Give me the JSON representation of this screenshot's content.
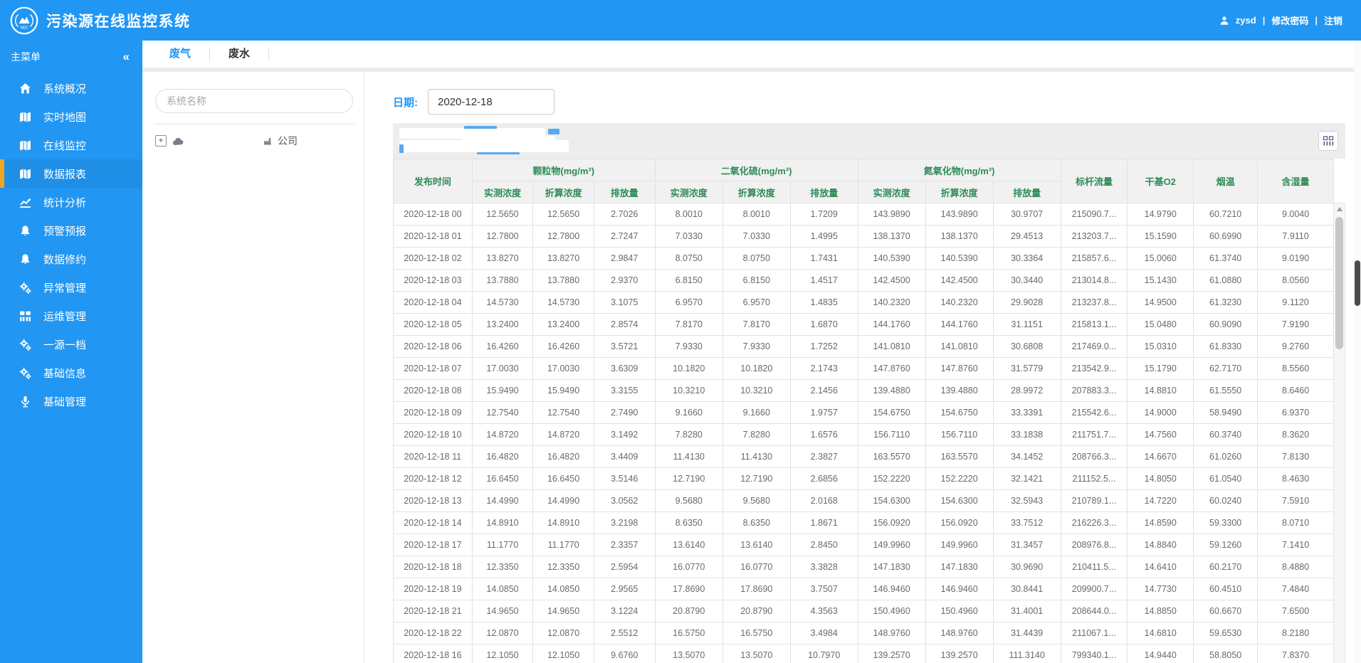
{
  "colors": {
    "primary": "#2196F3",
    "accent_yellow": "#F2A61F",
    "table_header_green": "#2E8B57"
  },
  "topbar": {
    "title": "污染源在线监控系统",
    "user": "zysd",
    "separator": "|",
    "links": [
      "修改密码",
      "注销"
    ]
  },
  "sidebar": {
    "header": "主菜单",
    "collapse_icon": "«",
    "items": [
      {
        "key": "system-overview",
        "label": "系统概况",
        "icon": "home-icon",
        "active": false
      },
      {
        "key": "realtime-map",
        "label": "实时地图",
        "icon": "map-icon",
        "active": false
      },
      {
        "key": "online-monitoring",
        "label": "在线监控",
        "icon": "map-icon",
        "active": false
      },
      {
        "key": "data-reports",
        "label": "数据报表",
        "icon": "map-icon",
        "active": true
      },
      {
        "key": "statistics-analysis",
        "label": "统计分析",
        "icon": "chart-icon",
        "active": false
      },
      {
        "key": "warning-forecast",
        "label": "预警预报",
        "icon": "bell-icon",
        "active": false
      },
      {
        "key": "data-revision",
        "label": "数据修约",
        "icon": "bell-icon",
        "active": false
      },
      {
        "key": "exception-management",
        "label": "异常管理",
        "icon": "gears-icon",
        "active": false
      },
      {
        "key": "operations-management",
        "label": "运维管理",
        "icon": "grid-icon",
        "active": false
      },
      {
        "key": "one-source-one-file",
        "label": "一源一档",
        "icon": "gears-icon",
        "active": false
      },
      {
        "key": "basic-info",
        "label": "基础信息",
        "icon": "gears-icon",
        "active": false
      },
      {
        "key": "basic-management",
        "label": "基础管理",
        "icon": "mic-icon",
        "active": false
      }
    ]
  },
  "tabs": [
    {
      "key": "waste-gas",
      "label": "废气",
      "active": true
    },
    {
      "key": "waste-water",
      "label": "废水",
      "active": false
    }
  ],
  "tree": {
    "search_placeholder": "系统名称",
    "expand_glyph": "+",
    "node_suffix": "公司"
  },
  "main": {
    "date_label": "日期:",
    "date_value": "2020-12-18"
  },
  "table": {
    "col_time": "发布时间",
    "groups": [
      {
        "label": "颗粒物(mg/m³)",
        "children": [
          "实测浓度",
          "折算浓度",
          "排放量"
        ]
      },
      {
        "label": "二氧化硫(mg/m³)",
        "children": [
          "实测浓度",
          "折算浓度",
          "排放量"
        ]
      },
      {
        "label": "氮氧化物(mg/m³)",
        "children": [
          "实测浓度",
          "折算浓度",
          "排放量"
        ]
      }
    ],
    "single_cols": [
      "标杆流量",
      "干基O2",
      "烟温",
      "含湿量"
    ],
    "rows": [
      [
        "2020-12-18 00",
        "12.5650",
        "12.5650",
        "2.7026",
        "8.0010",
        "8.0010",
        "1.7209",
        "143.9890",
        "143.9890",
        "30.9707",
        "215090.7...",
        "14.9790",
        "60.7210",
        "9.0040"
      ],
      [
        "2020-12-18 01",
        "12.7800",
        "12.7800",
        "2.7247",
        "7.0330",
        "7.0330",
        "1.4995",
        "138.1370",
        "138.1370",
        "29.4513",
        "213203.7...",
        "15.1590",
        "60.6990",
        "7.9110"
      ],
      [
        "2020-12-18 02",
        "13.8270",
        "13.8270",
        "2.9847",
        "8.0750",
        "8.0750",
        "1.7431",
        "140.5390",
        "140.5390",
        "30.3364",
        "215857.6...",
        "15.0060",
        "61.3740",
        "9.0190"
      ],
      [
        "2020-12-18 03",
        "13.7880",
        "13.7880",
        "2.9370",
        "6.8150",
        "6.8150",
        "1.4517",
        "142.4500",
        "142.4500",
        "30.3440",
        "213014.8...",
        "15.1430",
        "61.0880",
        "8.0560"
      ],
      [
        "2020-12-18 04",
        "14.5730",
        "14.5730",
        "3.1075",
        "6.9570",
        "6.9570",
        "1.4835",
        "140.2320",
        "140.2320",
        "29.9028",
        "213237.8...",
        "14.9500",
        "61.3230",
        "9.1120"
      ],
      [
        "2020-12-18 05",
        "13.2400",
        "13.2400",
        "2.8574",
        "7.8170",
        "7.8170",
        "1.6870",
        "144.1760",
        "144.1760",
        "31.1151",
        "215813.1...",
        "15.0480",
        "60.9090",
        "7.9190"
      ],
      [
        "2020-12-18 06",
        "16.4260",
        "16.4260",
        "3.5721",
        "7.9330",
        "7.9330",
        "1.7252",
        "141.0810",
        "141.0810",
        "30.6808",
        "217469.0...",
        "15.0310",
        "61.8330",
        "9.2760"
      ],
      [
        "2020-12-18 07",
        "17.0030",
        "17.0030",
        "3.6309",
        "10.1820",
        "10.1820",
        "2.1743",
        "147.8760",
        "147.8760",
        "31.5779",
        "213542.9...",
        "15.1790",
        "62.7170",
        "8.5560"
      ],
      [
        "2020-12-18 08",
        "15.9490",
        "15.9490",
        "3.3155",
        "10.3210",
        "10.3210",
        "2.1456",
        "139.4880",
        "139.4880",
        "28.9972",
        "207883.3...",
        "14.8810",
        "61.5550",
        "8.6460"
      ],
      [
        "2020-12-18 09",
        "12.7540",
        "12.7540",
        "2.7490",
        "9.1660",
        "9.1660",
        "1.9757",
        "154.6750",
        "154.6750",
        "33.3391",
        "215542.6...",
        "14.9000",
        "58.9490",
        "6.9370"
      ],
      [
        "2020-12-18 10",
        "14.8720",
        "14.8720",
        "3.1492",
        "7.8280",
        "7.8280",
        "1.6576",
        "156.7110",
        "156.7110",
        "33.1838",
        "211751.7...",
        "14.7560",
        "60.3740",
        "8.3620"
      ],
      [
        "2020-12-18 11",
        "16.4820",
        "16.4820",
        "3.4409",
        "11.4130",
        "11.4130",
        "2.3827",
        "163.5570",
        "163.5570",
        "34.1452",
        "208766.3...",
        "14.6670",
        "61.0260",
        "7.8130"
      ],
      [
        "2020-12-18 12",
        "16.6450",
        "16.6450",
        "3.5146",
        "12.7190",
        "12.7190",
        "2.6856",
        "152.2220",
        "152.2220",
        "32.1421",
        "211152.5...",
        "14.8050",
        "61.0540",
        "8.4630"
      ],
      [
        "2020-12-18 13",
        "14.4990",
        "14.4990",
        "3.0562",
        "9.5680",
        "9.5680",
        "2.0168",
        "154.6300",
        "154.6300",
        "32.5943",
        "210789.1...",
        "14.7220",
        "60.0240",
        "7.5910"
      ],
      [
        "2020-12-18 14",
        "14.8910",
        "14.8910",
        "3.2198",
        "8.6350",
        "8.6350",
        "1.8671",
        "156.0920",
        "156.0920",
        "33.7512",
        "216226.3...",
        "14.8590",
        "59.3300",
        "8.0710"
      ],
      [
        "2020-12-18 17",
        "11.1770",
        "11.1770",
        "2.3357",
        "13.6140",
        "13.6140",
        "2.8450",
        "149.9960",
        "149.9960",
        "31.3457",
        "208976.8...",
        "14.8840",
        "59.1260",
        "7.1410"
      ],
      [
        "2020-12-18 18",
        "12.3350",
        "12.3350",
        "2.5954",
        "16.0770",
        "16.0770",
        "3.3828",
        "147.1830",
        "147.1830",
        "30.9690",
        "210411.5...",
        "14.6410",
        "60.2170",
        "8.4880"
      ],
      [
        "2020-12-18 19",
        "14.0850",
        "14.0850",
        "2.9565",
        "17.8690",
        "17.8690",
        "3.7507",
        "146.9460",
        "146.9460",
        "30.8441",
        "209900.7...",
        "14.7730",
        "60.4510",
        "7.4840"
      ],
      [
        "2020-12-18 21",
        "14.9650",
        "14.9650",
        "3.1224",
        "20.8790",
        "20.8790",
        "4.3563",
        "150.4960",
        "150.4960",
        "31.4001",
        "208644.0...",
        "14.8850",
        "60.6670",
        "7.6500"
      ],
      [
        "2020-12-18 22",
        "12.0870",
        "12.0870",
        "2.5512",
        "16.5750",
        "16.5750",
        "3.4984",
        "148.9760",
        "148.9760",
        "31.4439",
        "211067.1...",
        "14.6810",
        "59.6530",
        "8.2180"
      ],
      [
        "2020-12-18 16",
        "12.1050",
        "12.1050",
        "9.6760",
        "13.5070",
        "13.5070",
        "10.7970",
        "139.2570",
        "139.2570",
        "111.3140",
        "799340.1...",
        "14.9440",
        "58.8050",
        "7.8370"
      ]
    ]
  }
}
